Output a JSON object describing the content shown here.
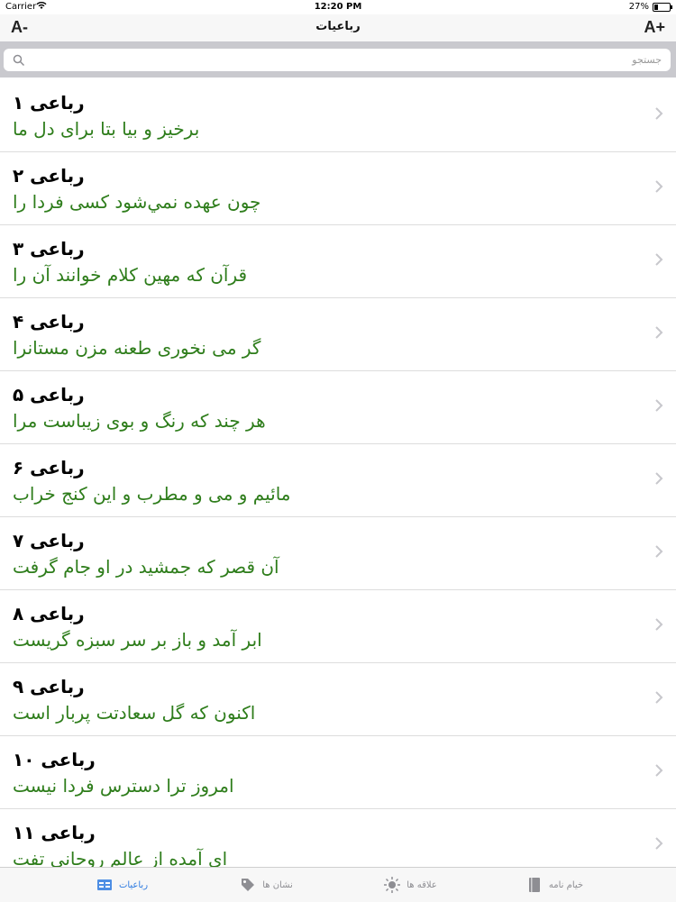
{
  "status_bar": {
    "carrier": "Carrier",
    "time": "12:20 PM",
    "battery": "27%",
    "battery_level": 0.27
  },
  "nav": {
    "title": "رباعیات",
    "font_decrease": "A-",
    "font_increase": "A+"
  },
  "search": {
    "placeholder": "جستجو",
    "value": ""
  },
  "rows": [
    {
      "title": "رباعی ۱",
      "subtitle": "برخیز و بیا بتا برای دل ما"
    },
    {
      "title": "رباعی ۲",
      "subtitle": "چون عهده نمي‌شود کسی فردا را"
    },
    {
      "title": "رباعی ۳",
      "subtitle": "قرآن که مهین کلام خوانند آن را"
    },
    {
      "title": "رباعی ۴",
      "subtitle": "گر می نخوری طعنه مزن مستانرا"
    },
    {
      "title": "رباعی ۵",
      "subtitle": "هر چند که رنگ و بوی زیباست مرا"
    },
    {
      "title": "رباعی ۶",
      "subtitle": "مائیم و می و مطرب و این کنج خراب"
    },
    {
      "title": "رباعی ۷",
      "subtitle": "آن قصر که جمشید در او جام گرفت"
    },
    {
      "title": "رباعی ۸",
      "subtitle": "ابر آمد و باز بر سر سبزه گریست"
    },
    {
      "title": "رباعی ۹",
      "subtitle": "اکنون که گل سعادتت پربار است"
    },
    {
      "title": "رباعی ۱۰",
      "subtitle": "امروز ترا دسترس فردا نیست"
    },
    {
      "title": "رباعی ۱۱",
      "subtitle": "ای آمده از عالم روحانی تفت"
    }
  ],
  "tabs": [
    {
      "label": "رباعیات",
      "icon": "quatrains-icon",
      "active": true
    },
    {
      "label": "نشان ها",
      "icon": "tag-icon",
      "active": false
    },
    {
      "label": "علاقه ها",
      "icon": "sun-icon",
      "active": false
    },
    {
      "label": "خیام نامه",
      "icon": "book-icon",
      "active": false
    }
  ],
  "colors": {
    "accent": "#2f7be0",
    "subtitle": "#2e7d1b",
    "search_bg": "#c9c9ce"
  }
}
